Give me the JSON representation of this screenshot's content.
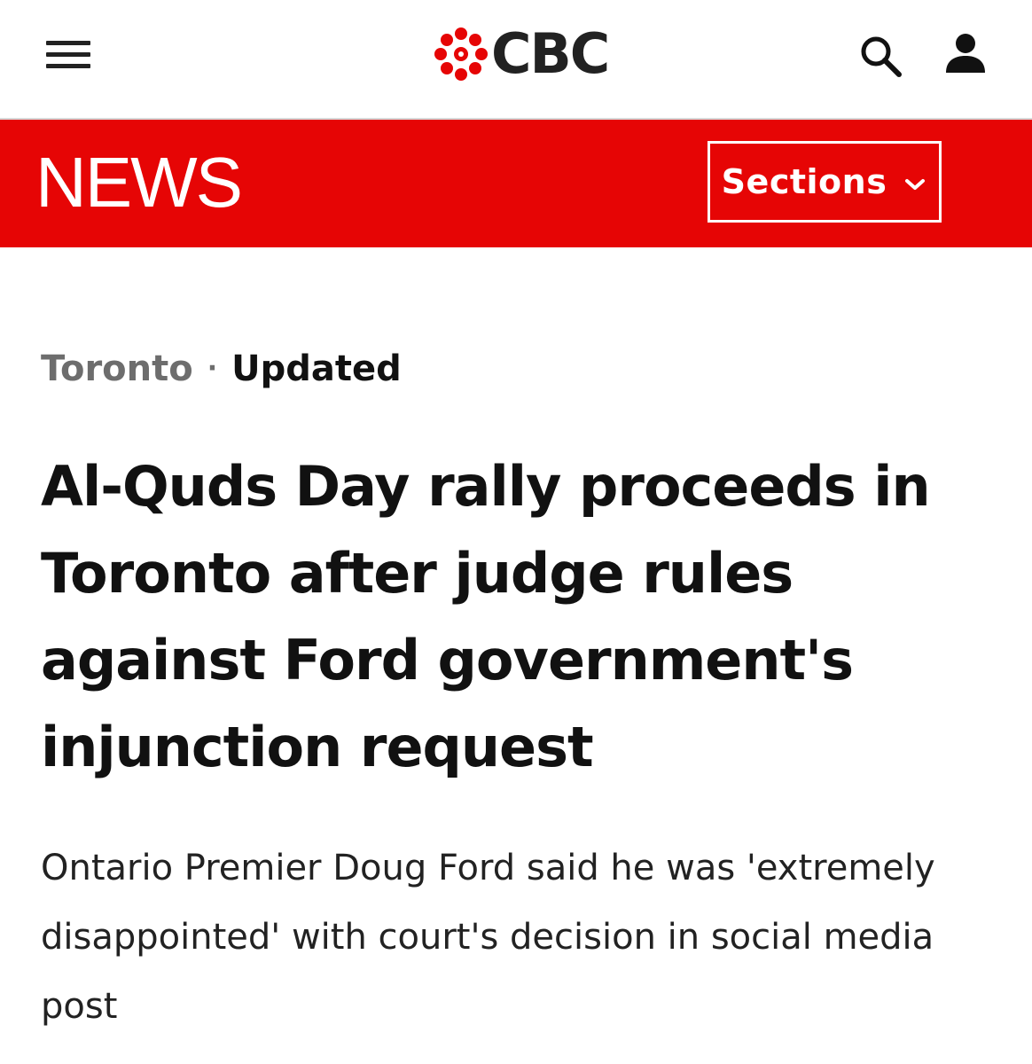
{
  "header": {
    "menu_icon": "hamburger-menu-icon",
    "logo_text": "CBC",
    "logo_icon": "cbc-gem-icon",
    "search_icon": "search-icon",
    "account_icon": "user-account-icon",
    "brand_color": "#e60505"
  },
  "newsbar": {
    "title": "NEWS",
    "sections_label": "Sections",
    "sections_icon": "chevron-down-icon",
    "background_color": "#e60505"
  },
  "article": {
    "location": "Toronto",
    "separator": "·",
    "status": "Updated",
    "headline": "Al-Quds Day rally proceeds in Toronto after judge rules against Ford government's injunction request",
    "deck": "Ontario Premier Doug Ford said he was 'extremely disappointed' with court's decision in social media post"
  }
}
